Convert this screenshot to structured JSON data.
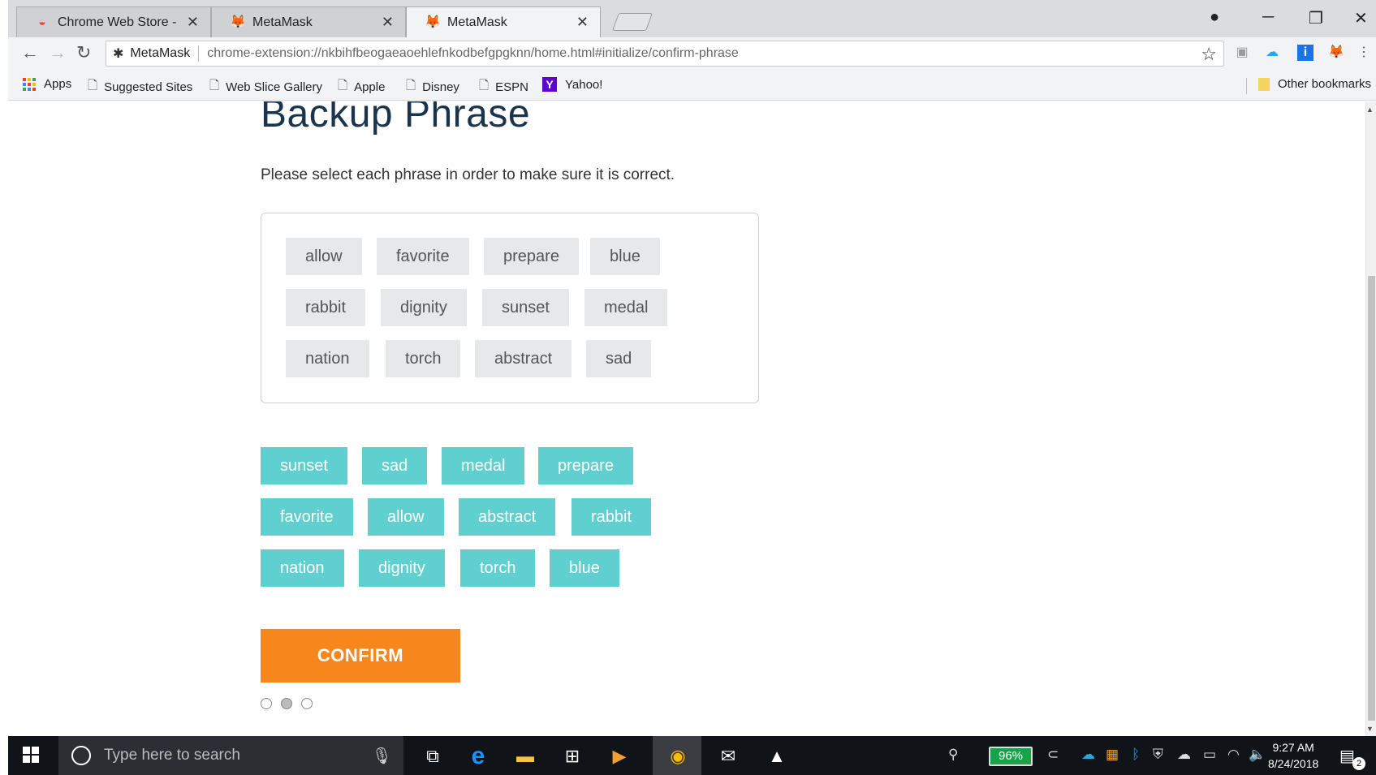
{
  "browser": {
    "tabs": [
      {
        "title": "Chrome Web Store - met",
        "active": false
      },
      {
        "title": "MetaMask",
        "active": false
      },
      {
        "title": "MetaMask",
        "active": true
      }
    ],
    "omnibox": {
      "site_label": "MetaMask",
      "url": "chrome-extension://nkbihfbeogaeaoehlefnkodbefgpgknn/home.html#initialize/confirm-phrase"
    },
    "bookmarks": [
      {
        "label": "Apps"
      },
      {
        "label": "Suggested Sites"
      },
      {
        "label": "Web Slice Gallery"
      },
      {
        "label": "Apple"
      },
      {
        "label": "Disney"
      },
      {
        "label": "ESPN"
      },
      {
        "label": "Yahoo!"
      }
    ],
    "other_bookmarks": "Other bookmarks"
  },
  "page": {
    "title": "Backup Phrase",
    "instruction": "Please select each phrase in order to make sure it is correct.",
    "selected_words": [
      "allow",
      "favorite",
      "prepare",
      "blue",
      "rabbit",
      "dignity",
      "sunset",
      "medal",
      "nation",
      "torch",
      "abstract",
      "sad"
    ],
    "available_words": [
      "sunset",
      "sad",
      "medal",
      "prepare",
      "favorite",
      "allow",
      "abstract",
      "rabbit",
      "nation",
      "dignity",
      "torch",
      "blue"
    ],
    "confirm_label": "CONFIRM",
    "steps": [
      {
        "filled": false
      },
      {
        "filled": true
      },
      {
        "filled": false
      }
    ]
  },
  "taskbar": {
    "search_placeholder": "Type here to search",
    "battery": "96%",
    "time": "9:27 AM",
    "date": "8/24/2018",
    "notifications": "2"
  },
  "colors": {
    "confirm": "#f7861c",
    "word_chip": "#5fcfcf",
    "selected_chip": "#e7e8ea",
    "title": "#1b344d"
  }
}
